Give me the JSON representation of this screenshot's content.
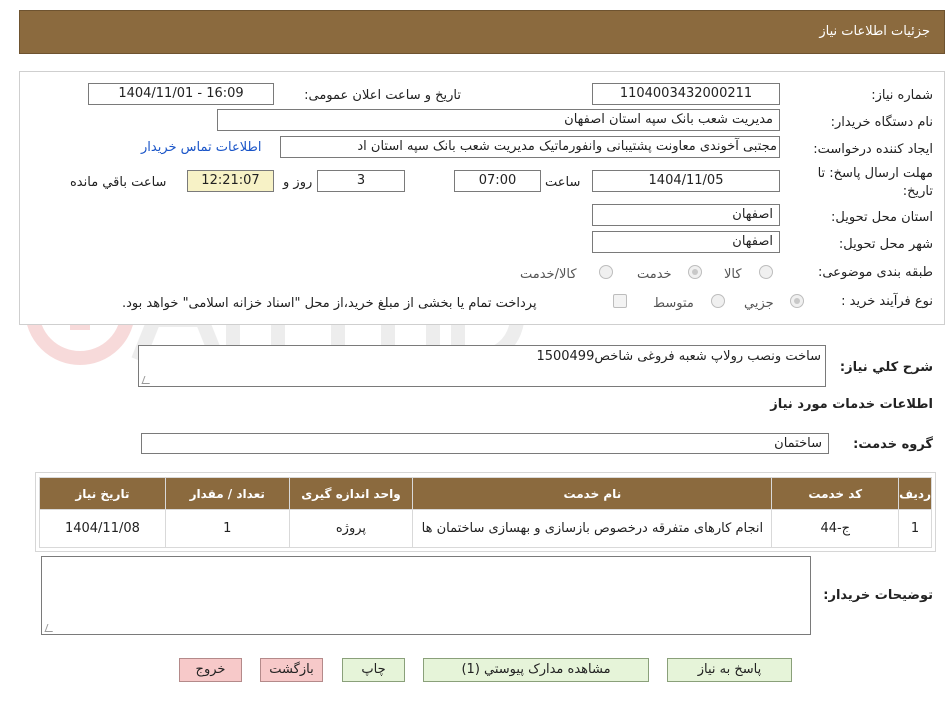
{
  "header": {
    "title": "جزئیات اطلاعات نیاز"
  },
  "form": {
    "need_number_label": "شماره نیاز:",
    "need_number": "1104003432000211",
    "announce_label": "تاریخ و ساعت اعلان عمومی:",
    "announce_value": "1404/11/01 - 16:09",
    "buyer_org_label": "نام دستگاه خریدار:",
    "buyer_org": "مدیریت شعب بانک سپه استان اصفهان",
    "requester_label": "ایجاد کننده درخواست:",
    "requester": "مجتبی آخوندی معاونت پشتیبانی وانفورماتیک مدیریت شعب بانک سپه استان اد",
    "contact_link": "اطلاعات تماس خریدار",
    "deadline_label": "مهلت ارسال پاسخ: تا تاریخ:",
    "deadline_date": "1404/11/05",
    "time_label": "ساعت",
    "deadline_time": "07:00",
    "days_value": "3",
    "days_label": "روز و",
    "remaining_time": "12:21:07",
    "remaining_label": "ساعت باقي مانده",
    "province_label": "استان محل تحویل:",
    "province": "اصفهان",
    "city_label": "شهر محل تحویل:",
    "city": "اصفهان",
    "category_label": "طبقه بندی موضوعی:",
    "category_options": [
      "کالا",
      "خدمت",
      "کالا/خدمت"
    ],
    "process_label": "نوع فرآیند خرید :",
    "process_options": [
      "جزیي",
      "متوسط"
    ],
    "payment_note": "پرداخت تمام یا بخشی از مبلغ خرید،از محل \"اسناد خزانه اسلامی\" خواهد بود."
  },
  "summary": {
    "label": "شرح کلي نیاز:",
    "value": "ساخت ونصب رولاپ شعبه فروغی شاخص1500499"
  },
  "services": {
    "section_title": "اطلاعات خدمات مورد نیاز",
    "group_label": "گروه خدمت:",
    "group_value": "ساختمان",
    "columns": [
      "ردیف",
      "کد خدمت",
      "نام خدمت",
      "واحد اندازه گیری",
      "تعداد / مقدار",
      "تاریخ نیاز"
    ],
    "rows": [
      [
        "1",
        "ج-44",
        "انجام کارهای متفرقه درخصوص بازسازی و بهسازی ساختمان ها",
        "پروژه",
        "1",
        "1404/11/08"
      ]
    ]
  },
  "notes": {
    "label": "توضیحات خریدار:"
  },
  "buttons": {
    "reply": "پاسخ به نیاز",
    "attachments": "مشاهده مدارک پیوستي (1)",
    "print": "چاپ",
    "back": "بازگشت",
    "exit": "خروج"
  },
  "colors": {
    "header_bg": "#8b6a3e",
    "button_green": "#e6f4d9",
    "button_red": "#f7c9c9",
    "link": "#1a55c8"
  }
}
